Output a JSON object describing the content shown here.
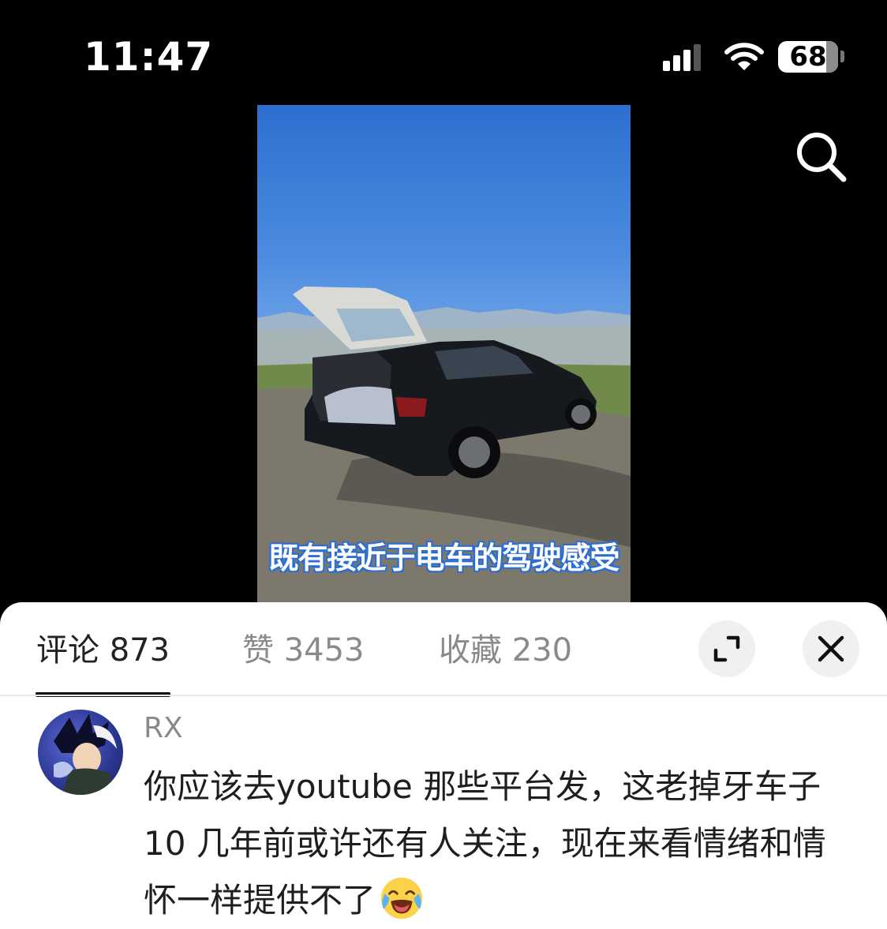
{
  "status_bar": {
    "time": "11:47",
    "battery_percent": "68",
    "signal_bars_active": 3,
    "signal_bars_total": 4
  },
  "top_actions": {
    "search_icon": "search-icon"
  },
  "video": {
    "subtitle": "既有接近于电车的驾驶感受"
  },
  "sheet": {
    "tabs": [
      {
        "label": "评论 873",
        "active": true
      },
      {
        "label": "赞 3453",
        "active": false
      },
      {
        "label": "收藏 230",
        "active": false
      }
    ],
    "expand_icon": "expand-icon",
    "close_icon": "close-icon"
  },
  "comment": {
    "username": "RX",
    "text": "你应该去youtube 那些平台发，这老掉牙车子10 几年前或许还有人关注，现在来看情绪和情怀一样提供不了",
    "emoji": "crying-laughing-emoji"
  },
  "colors": {
    "background": "#000000",
    "sheet": "#ffffff",
    "subtitle_outline": "#2a6fd6",
    "inactive_text": "#8a8a8a"
  }
}
